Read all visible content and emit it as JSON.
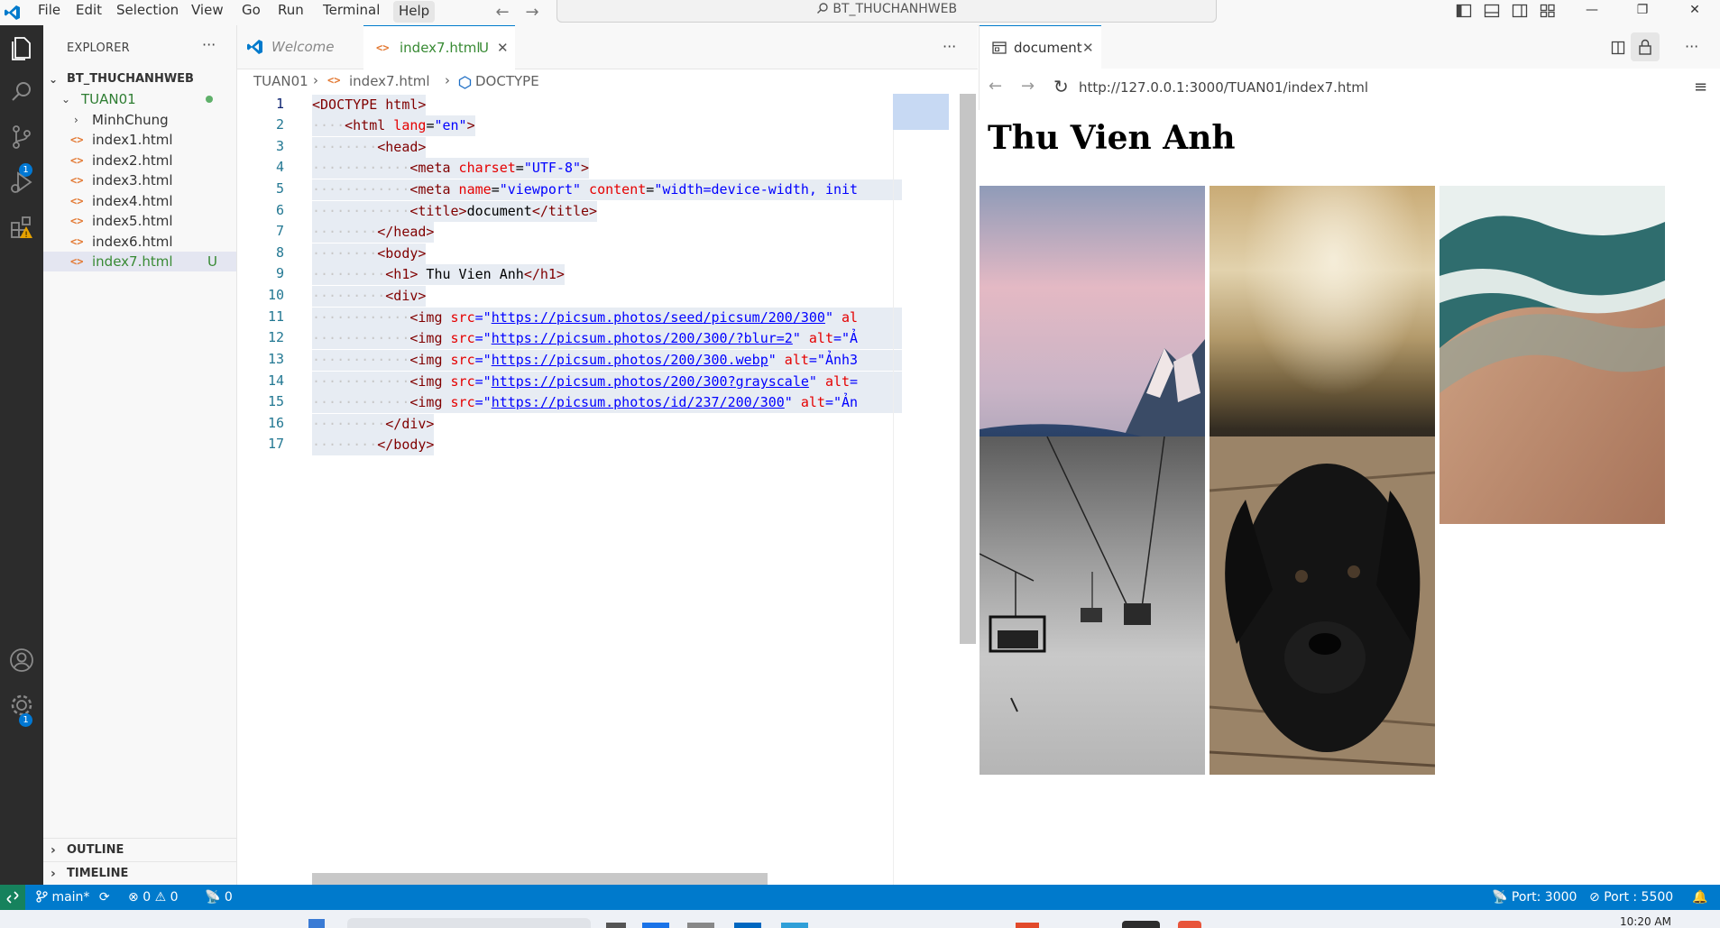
{
  "titlebar": {
    "menu": [
      "File",
      "Edit",
      "Selection",
      "View",
      "Go",
      "Run",
      "Terminal",
      "Help"
    ],
    "active_menu": "Help",
    "command_center": "BT_THUCHANHWEB",
    "window_buttons": [
      "—",
      "❐",
      "✕"
    ]
  },
  "activitybar": {
    "icons": [
      "explorer-icon",
      "search-icon",
      "source-control-icon",
      "run-debug-icon",
      "extensions-icon",
      "accounts-icon",
      "manage-icon"
    ],
    "source_control_badge": "1",
    "manage_badge": "1"
  },
  "sidebar": {
    "title": "EXPLORER",
    "more": "···",
    "workspace": "BT_THUCHANHWEB",
    "folder": "TUAN01",
    "items": [
      {
        "label": "MinhChung",
        "type": "folder",
        "status": ""
      },
      {
        "label": "index1.html",
        "type": "file",
        "status": ""
      },
      {
        "label": "index2.html",
        "type": "file",
        "status": ""
      },
      {
        "label": "index3.html",
        "type": "file",
        "status": ""
      },
      {
        "label": "index4.html",
        "type": "file",
        "status": ""
      },
      {
        "label": "index5.html",
        "type": "file",
        "status": ""
      },
      {
        "label": "index6.html",
        "type": "file",
        "status": ""
      },
      {
        "label": "index7.html",
        "type": "file",
        "status": "U"
      }
    ],
    "outline": "OUTLINE",
    "timeline": "TIMELINE"
  },
  "editor": {
    "tabs": [
      {
        "label": "Welcome",
        "active": false
      },
      {
        "label": "index7.html",
        "status": "U",
        "active": true
      }
    ],
    "more": "···",
    "breadcrumbs": [
      "TUAN01",
      "index7.html",
      "DOCTYPE"
    ],
    "line_numbers": [
      "1",
      "2",
      "3",
      "4",
      "5",
      "6",
      "7",
      "8",
      "9",
      "10",
      "11",
      "12",
      "13",
      "14",
      "15",
      "16",
      "17"
    ],
    "current_line": "1",
    "code": {
      "l1": {
        "a": "<DOCTYPE",
        "b": " html>"
      },
      "l2": {
        "a": "<html",
        "b": " lang",
        "c": "=",
        "d": "\"en\"",
        "e": ">"
      },
      "l3": {
        "a": "<head>"
      },
      "l4": {
        "a": "<meta",
        "b": " charset",
        "c": "=",
        "d": "\"UTF-8\"",
        "e": ">"
      },
      "l5": {
        "a": "<meta",
        "b": " name",
        "c": "=",
        "d": "\"viewport\"",
        "e": " content",
        "f": "=",
        "g": "\"width=device-width, init"
      },
      "l6": {
        "a": "<title>",
        "b": "document",
        "c": "</title>"
      },
      "l7": {
        "a": "</head>"
      },
      "l8": {
        "a": "<body>"
      },
      "l9": {
        "a": "<h1>",
        "b": " Thu Vien Anh",
        "c": "</h1>"
      },
      "l10": {
        "a": "<div>"
      },
      "l11": {
        "a": "<img",
        "b": " src",
        "c": "=\"",
        "d": "https://picsum.photos/seed/picsum/200/300",
        "e": "\"",
        "f": " al"
      },
      "l12": {
        "a": "<img",
        "b": " src",
        "c": "=\"",
        "d": "https://picsum.photos/200/300/?blur=2",
        "e": "\"",
        "f": " alt",
        "g": "=\"Ả"
      },
      "l13": {
        "a": "<img",
        "b": " src",
        "c": "=\"",
        "d": "https://picsum.photos/200/300.webp",
        "e": "\"",
        "f": " alt",
        "g": "=\"Ảnh3"
      },
      "l14": {
        "a": "<img",
        "b": " src",
        "c": "=\"",
        "d": "https://picsum.photos/200/300?grayscale",
        "e": "\"",
        "f": " alt",
        "g": "="
      },
      "l15": {
        "a": "<img",
        "b": " src",
        "c": "=\"",
        "d": "https://picsum.photos/id/237/200/300",
        "e": "\"",
        "f": " alt",
        "g": "=\"Ản"
      },
      "l16": {
        "a": "</div>"
      },
      "l17": {
        "a": "</body>"
      }
    }
  },
  "preview": {
    "tab": "document",
    "url": "http://127.0.0.1:3000/TUAN01/index7.html",
    "page_heading": "Thu Vien Anh",
    "images": [
      {
        "name": "mountain-sky-photo"
      },
      {
        "name": "blurred-landscape-photo"
      },
      {
        "name": "beach-wave-photo"
      },
      {
        "name": "grayscale-cable-car-photo"
      },
      {
        "name": "black-puppy-photo"
      }
    ]
  },
  "statusbar": {
    "branch": "main*",
    "errors": "0",
    "warnings": "0",
    "ports": "0",
    "port_live": "Port: 3000",
    "port_server": "Port : 5500"
  },
  "taskbar": {
    "clock": "10:20 AM"
  },
  "colors": {
    "accent": "#007acc",
    "activitybar": "#2c2c2c",
    "untracked": "#73c991"
  }
}
